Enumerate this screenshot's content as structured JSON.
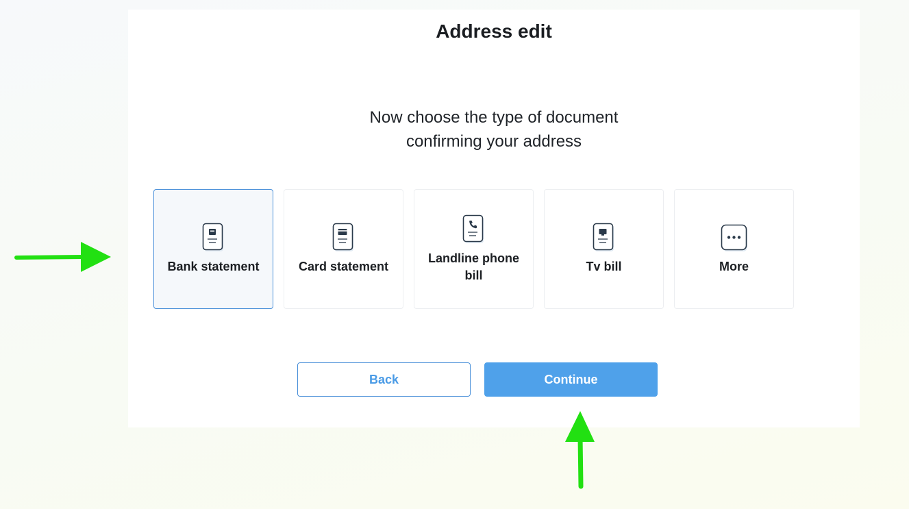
{
  "header": {
    "title": "Address edit"
  },
  "prompt": {
    "line1": "Now choose the type of document",
    "line2": "confirming your address"
  },
  "document_types": [
    {
      "label": "Bank statement",
      "icon": "bank-statement-icon",
      "selected": true
    },
    {
      "label": "Card statement",
      "icon": "card-statement-icon",
      "selected": false
    },
    {
      "label": "Landline phone bill",
      "icon": "phone-bill-icon",
      "selected": false
    },
    {
      "label": "Tv bill",
      "icon": "tv-bill-icon",
      "selected": false
    },
    {
      "label": "More",
      "icon": "more-icon",
      "selected": false
    }
  ],
  "actions": {
    "back_label": "Back",
    "continue_label": "Continue"
  },
  "colors": {
    "accent": "#4fa1ea",
    "selected_border": "#4a90d9",
    "annotation_arrow": "#22e012",
    "icon_stroke": "#2b3a4a"
  }
}
